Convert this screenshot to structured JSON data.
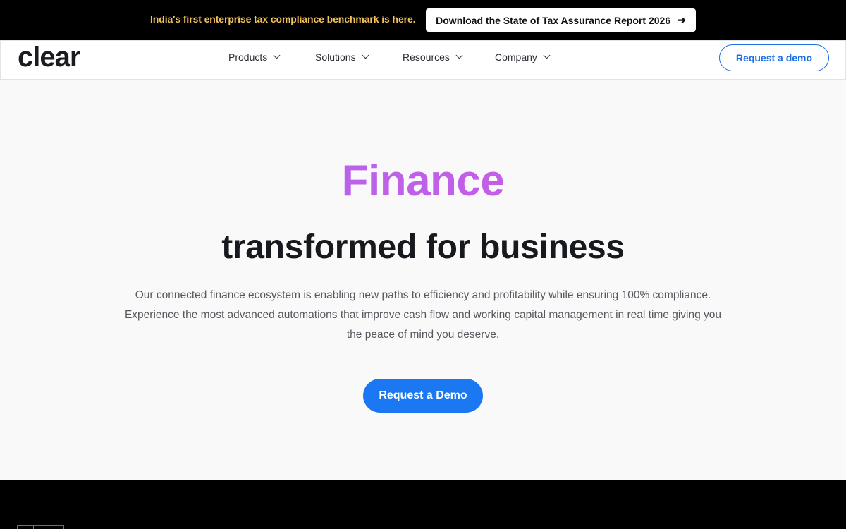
{
  "announcement": {
    "text": "India's first enterprise tax compliance benchmark is here.",
    "button_label": "Download the State of Tax Assurance Report 2026",
    "button_icon": "arrow-right-icon",
    "text_color": "#f2c15a"
  },
  "navbar": {
    "logo": "clear",
    "items": [
      {
        "label": "Products"
      },
      {
        "label": "Solutions"
      },
      {
        "label": "Resources"
      },
      {
        "label": "Company"
      }
    ],
    "cta_label": "Request a demo"
  },
  "hero": {
    "title": "Finance",
    "headline": "transformed for business",
    "description": "Our connected finance ecosystem is enabling new paths to efficiency and profitability while ensuring 100% compliance. Experience the most advanced automations that improve cash flow and working capital management in real time giving you the peace of mind you deserve.",
    "cta_label": "Request a Demo"
  },
  "colors": {
    "accent": "#1b78f2",
    "gradient_start": "#a66df0",
    "gradient_end": "#c45de6",
    "dark_bg": "#000000"
  }
}
